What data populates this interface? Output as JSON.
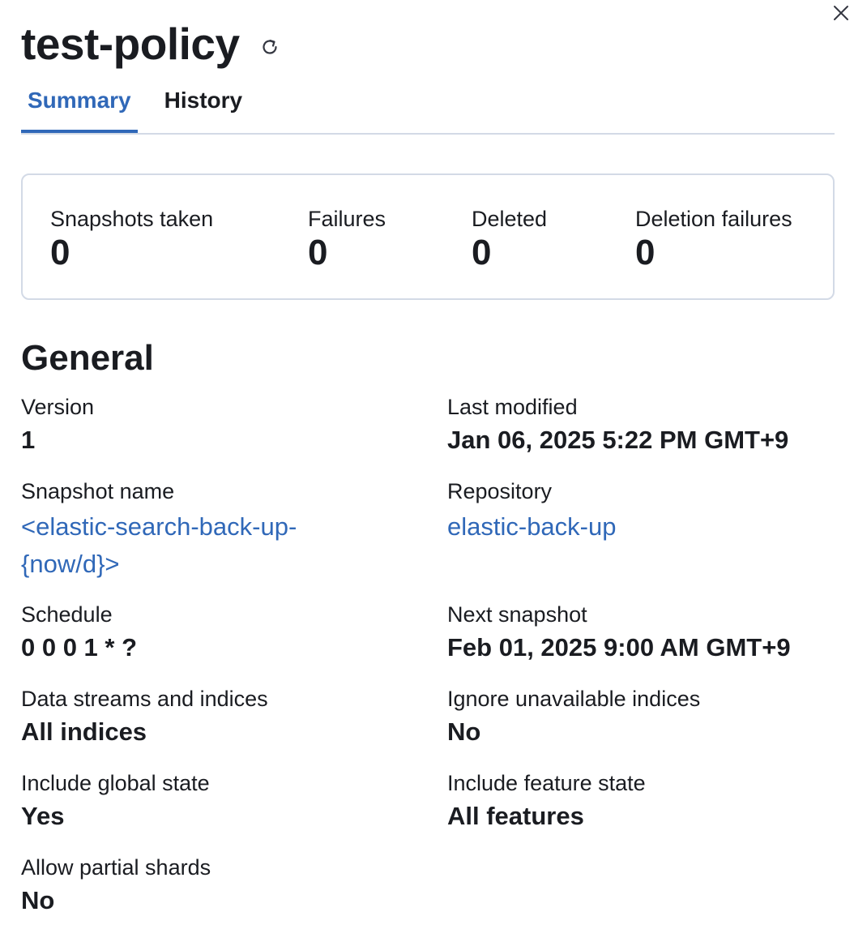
{
  "flyout": {
    "title": "test-policy",
    "close_icon": "close-icon",
    "refresh_icon": "refresh-icon"
  },
  "tabs": [
    {
      "label": "Summary",
      "active": true
    },
    {
      "label": "History",
      "active": false
    }
  ],
  "stats": [
    {
      "label": "Snapshots taken",
      "value": "0"
    },
    {
      "label": "Failures",
      "value": "0"
    },
    {
      "label": "Deleted",
      "value": "0"
    },
    {
      "label": "Deletion failures",
      "value": "0"
    }
  ],
  "general": {
    "title": "General",
    "version": {
      "label": "Version",
      "value": "1"
    },
    "last_modified": {
      "label": "Last modified",
      "value": "Jan 06, 2025 5:22 PM GMT+9"
    },
    "snapshot_name": {
      "label": "Snapshot name",
      "value_line1": "<elastic-search-back-up-",
      "value_line2": "{now/d}>"
    },
    "repository": {
      "label": "Repository",
      "value": "elastic-back-up"
    },
    "schedule": {
      "label": "Schedule",
      "value": "0 0 0 1 * ?"
    },
    "next_snapshot": {
      "label": "Next snapshot",
      "value": "Feb 01, 2025 9:00 AM GMT+9"
    },
    "data_streams": {
      "label": "Data streams and indices",
      "value": "All indices"
    },
    "ignore_unavailable": {
      "label": "Ignore unavailable indices",
      "value": "No"
    },
    "include_global_state": {
      "label": "Include global state",
      "value": "Yes"
    },
    "include_feature_state": {
      "label": "Include feature state",
      "value": "All features"
    },
    "allow_partial_shards": {
      "label": "Allow partial shards",
      "value": "No"
    }
  },
  "colors": {
    "link": "#3068b8",
    "text": "#1a1c21",
    "border": "#d3dae6"
  }
}
